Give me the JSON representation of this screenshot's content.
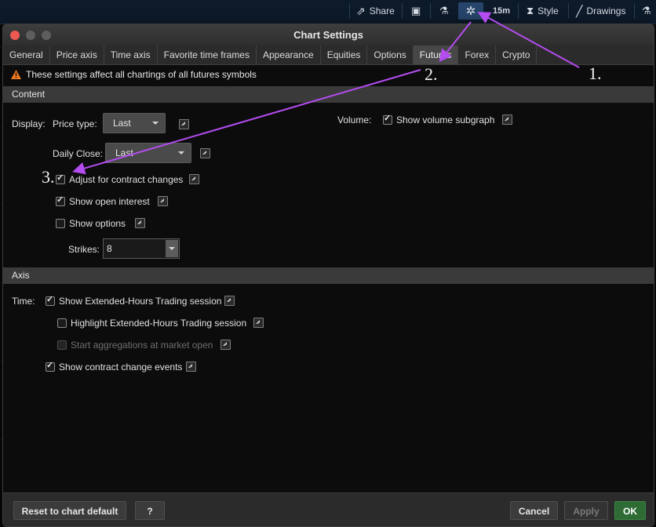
{
  "toolbar": {
    "share_label": "Share",
    "timeframe_label": "15m",
    "style_label": "Style",
    "drawings_label": "Drawings"
  },
  "dialog": {
    "title": "Chart Settings",
    "tabs": [
      "General",
      "Price axis",
      "Time axis",
      "Favorite time frames",
      "Appearance",
      "Equities",
      "Options",
      "Futures",
      "Forex",
      "Crypto"
    ],
    "active_tab": "Futures",
    "notice": "These settings affect all chartings of all futures symbols"
  },
  "content": {
    "section_label": "Content",
    "display_label": "Display:",
    "price_type_label": "Price type:",
    "price_type_value": "Last",
    "daily_close_label": "Daily Close:",
    "daily_close_value": "Last",
    "volume_label": "Volume:",
    "show_volume_subgraph": "Show volume subgraph",
    "adjust_contract_changes": "Adjust for contract changes",
    "show_open_interest": "Show open interest",
    "show_options": "Show options",
    "strikes_label": "Strikes:",
    "strikes_value": "8"
  },
  "axis": {
    "section_label": "Axis",
    "time_label": "Time:",
    "show_extended_hours": "Show Extended-Hours Trading session",
    "highlight_extended_hours": "Highlight Extended-Hours Trading session",
    "start_aggregations": "Start aggregations at market open",
    "show_contract_change_events": "Show contract change events"
  },
  "footer": {
    "reset_label": "Reset to chart default",
    "help_label": "?",
    "cancel_label": "Cancel",
    "apply_label": "Apply",
    "ok_label": "OK"
  },
  "annotations": {
    "step1": "1.",
    "step2": "2.",
    "step3": "3."
  },
  "colors": {
    "arrow": "#b44cf0",
    "ok_button": "#2e6b35",
    "warning": "#f07a1e",
    "toolbar_active": "#27456a"
  }
}
